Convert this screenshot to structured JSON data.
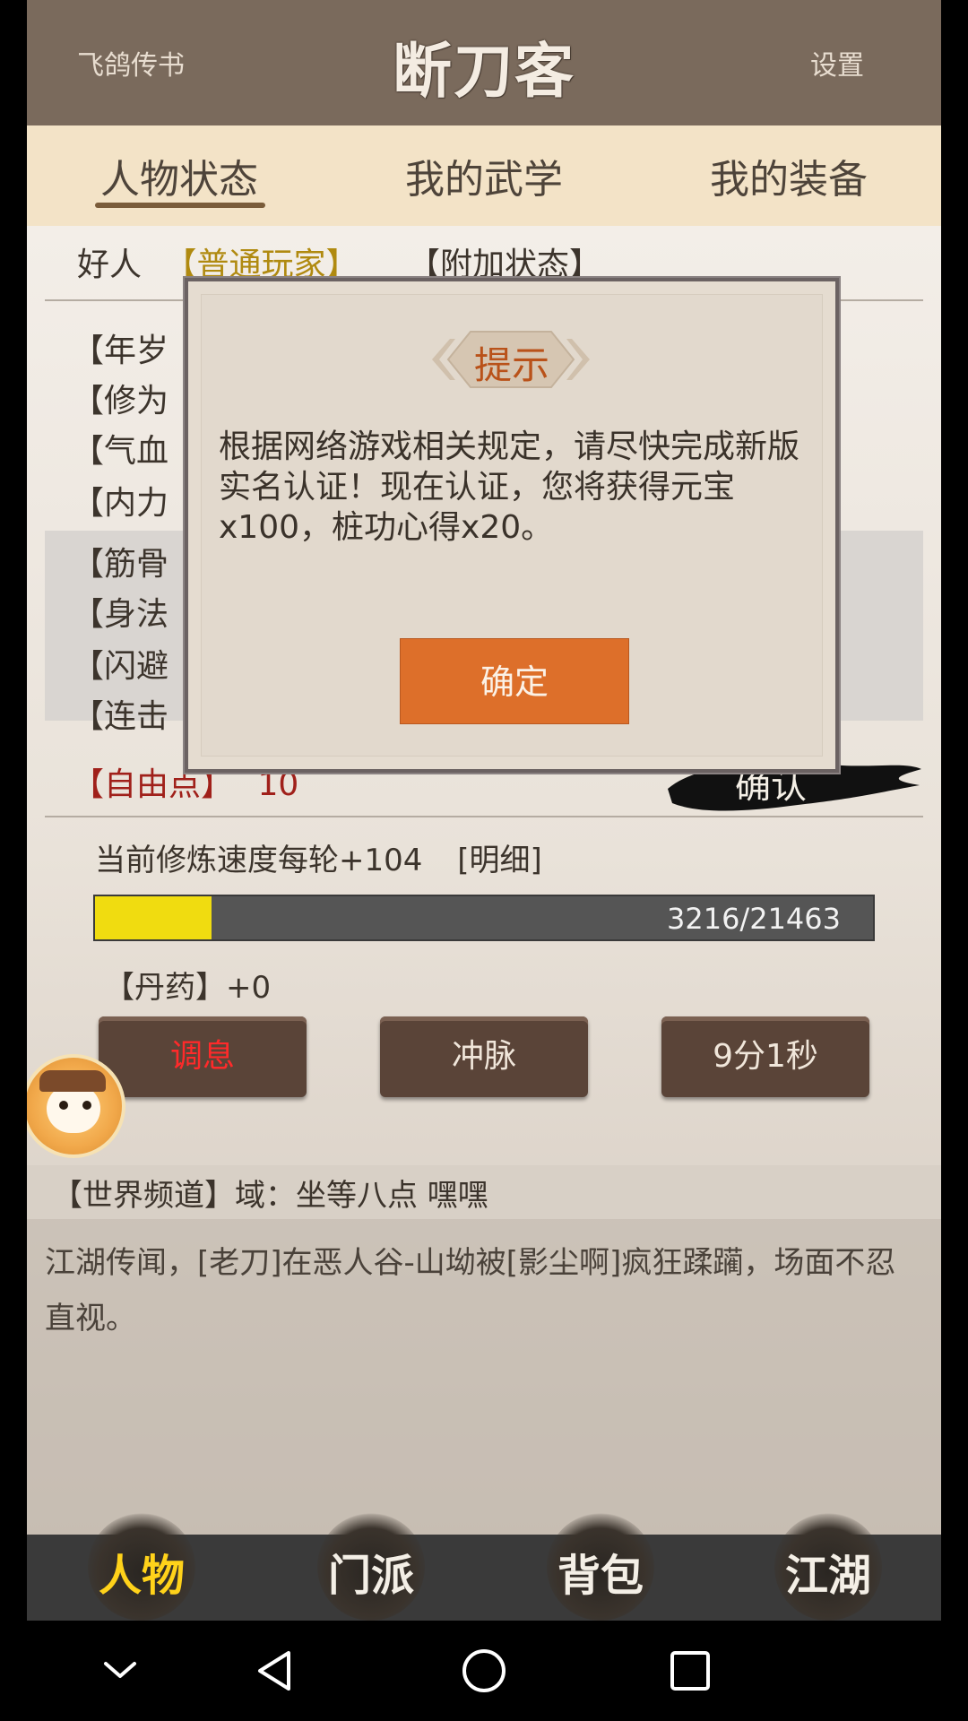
{
  "header": {
    "left": "飞鸽传书",
    "title": "断刀客",
    "right": "设置"
  },
  "tabs": [
    "人物状态",
    "我的武学",
    "我的装备"
  ],
  "status": {
    "label": "好人",
    "player_type": "【普通玩家】",
    "extra_state": "【附加状态】"
  },
  "attributes": [
    "【年岁",
    "【修为",
    "【气血",
    "【内力",
    "【筋骨",
    "【身法",
    "【闪避",
    "【连击"
  ],
  "free_points": {
    "label": "【自由点】",
    "value": "10"
  },
  "confirm_brush": "确认",
  "training": {
    "speed_text": "当前修炼速度每轮+104",
    "detail_link": "[明细]",
    "progress_text": "3216/21463",
    "progress_current": 3216,
    "progress_max": 21463,
    "dan_text": "【丹药】+0"
  },
  "buttons": {
    "rest": "调息",
    "meridian": "冲脉",
    "timer": "9分1秒"
  },
  "world_channel": "【世界频道】域：坐等八点  嘿嘿",
  "news": "江湖传闻，[老刀]在恶人谷-山坳被[影尘啊]疯狂蹂躏，场面不忍直视。",
  "bottom_nav": [
    "人物",
    "门派",
    "背包",
    "江湖"
  ],
  "dialog": {
    "title": "提示",
    "body": "根据网络游戏相关规定，请尽快完成新版实名认证！现在认证，您将获得元宝x100，桩功心得x20。",
    "confirm": "确定"
  },
  "colors": {
    "header_bg": "#7a6a5c",
    "tabs_bg": "#f3e3c7",
    "progress_fill": "#f0dc10",
    "dialog_button": "#dd6f2a"
  }
}
